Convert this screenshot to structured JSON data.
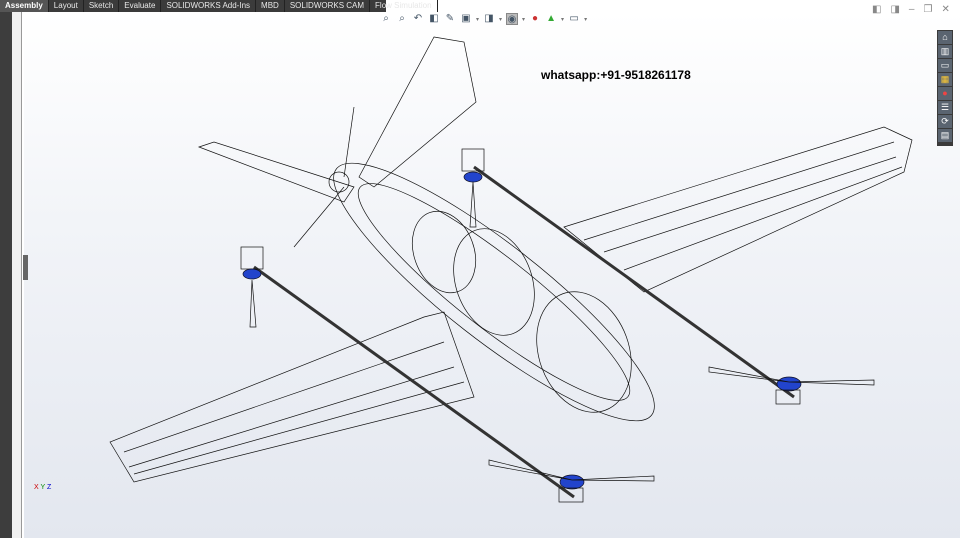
{
  "tabs": [
    "Assembly",
    "Layout",
    "Sketch",
    "Evaluate",
    "SOLIDWORKS Add-Ins",
    "MBD",
    "SOLIDWORKS CAM",
    "Flow Simulation"
  ],
  "active_tab": "Assembly",
  "heads_up_toolbar": [
    "zoom-to-fit-icon",
    "zoom-to-area-icon",
    "previous-view-icon",
    "section-view-icon",
    "dynamic-annotation-icon",
    "view-orientation-icon",
    "display-style-icon",
    "hide-show-items-icon",
    "edit-appearance-icon",
    "apply-scene-icon",
    "view-settings-icon"
  ],
  "window_controls": [
    "tile-left-icon",
    "tile-right-icon",
    "minimize-icon",
    "restore-icon",
    "close-icon"
  ],
  "task_pane": [
    "home-icon",
    "design-library-icon",
    "file-explorer-icon",
    "view-palette-icon",
    "appearances-icon",
    "custom-properties-icon",
    "solidworks-forum-icon",
    "toolbox-icon"
  ],
  "watermark": "whatsapp:+91-9518261178",
  "triad": {
    "x": "X",
    "y": "Y",
    "z": "Z"
  },
  "colors": {
    "tabbar": "#3b3b3b",
    "rotor_hub": "#2244cc"
  }
}
